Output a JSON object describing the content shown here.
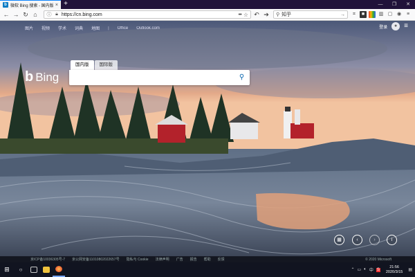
{
  "browser": {
    "tab_title": "微软 Bing 搜索 - 国内版",
    "url": "https://cn.bing.com",
    "search_placeholder": "知乎",
    "new_tab_label": "+",
    "close_tab_label": "×"
  },
  "bing": {
    "nav": [
      "图片",
      "视频",
      "学术",
      "词典",
      "地图",
      "|",
      "Office",
      "Outlook.com"
    ],
    "login": "登录",
    "logo_text": "Bing",
    "search_tabs": [
      {
        "label": "国内版",
        "active": true
      },
      {
        "label": "国际版",
        "active": false
      }
    ],
    "search_value": ""
  },
  "footer": {
    "links": [
      "京ICP备10036305号-7",
      "京公网安备11010802022657号",
      "隐私与 Cookie",
      "法律声明",
      "广告",
      "报告",
      "帮助",
      "反馈"
    ],
    "left_text": "",
    "copyright": "© 2020 Microsoft"
  },
  "taskbar": {
    "time": "21:56",
    "date": "2020/3/15",
    "ime": "中",
    "tray_s": "S"
  },
  "colors": {
    "bing_blue": "#0c68b0",
    "tab_accent": "#0a84ff",
    "titlebar": "#20123a"
  }
}
